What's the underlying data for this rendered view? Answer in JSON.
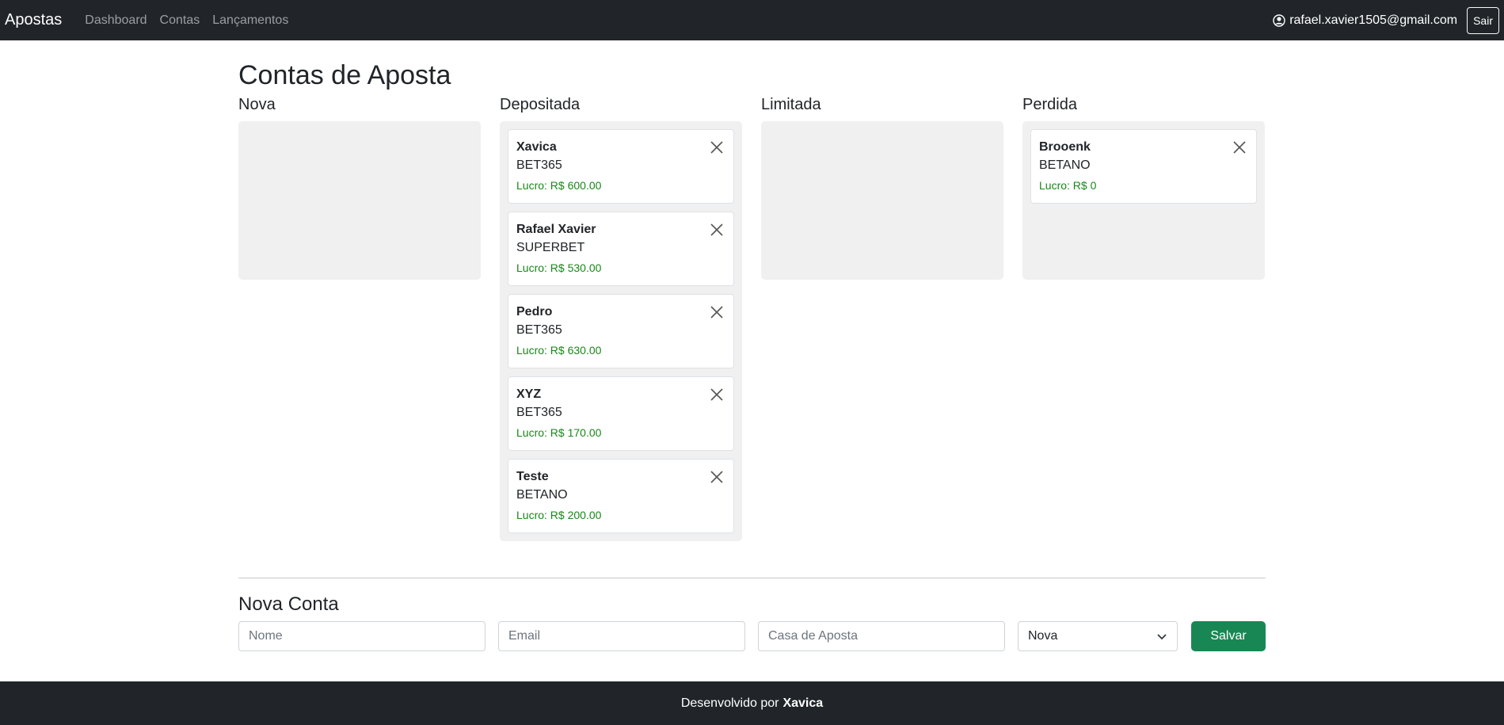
{
  "navbar": {
    "brand": "Apostas",
    "links": [
      "Dashboard",
      "Contas",
      "Lançamentos"
    ],
    "user_email": "rafael.xavier1505@gmail.com",
    "logout_label": "Sair"
  },
  "page": {
    "title": "Contas de Aposta"
  },
  "columns": [
    {
      "title": "Nova",
      "cards": []
    },
    {
      "title": "Depositada",
      "cards": [
        {
          "name": "Xavica",
          "house": "BET365",
          "profit": "Lucro: R$ 600.00"
        },
        {
          "name": "Rafael Xavier",
          "house": "SUPERBET",
          "profit": "Lucro: R$ 530.00"
        },
        {
          "name": "Pedro",
          "house": "BET365",
          "profit": "Lucro: R$ 630.00"
        },
        {
          "name": "XYZ",
          "house": "BET365",
          "profit": "Lucro: R$ 170.00"
        },
        {
          "name": "Teste",
          "house": "BETANO",
          "profit": "Lucro: R$ 200.00"
        }
      ]
    },
    {
      "title": "Limitada",
      "cards": []
    },
    {
      "title": "Perdida",
      "cards": [
        {
          "name": "Brooenk",
          "house": "BETANO",
          "profit": "Lucro: R$ 0"
        }
      ]
    }
  ],
  "form": {
    "title": "Nova Conta",
    "name_placeholder": "Nome",
    "email_placeholder": "Email",
    "house_placeholder": "Casa de Aposta",
    "status_selected": "Nova",
    "save_label": "Salvar"
  },
  "footer": {
    "prefix": "Desenvolvido por",
    "author": "Xavica"
  },
  "colors": {
    "navbar_bg": "#212529",
    "column_bg": "#f0f0f0",
    "profit_green": "#198719",
    "save_button": "#198754"
  }
}
